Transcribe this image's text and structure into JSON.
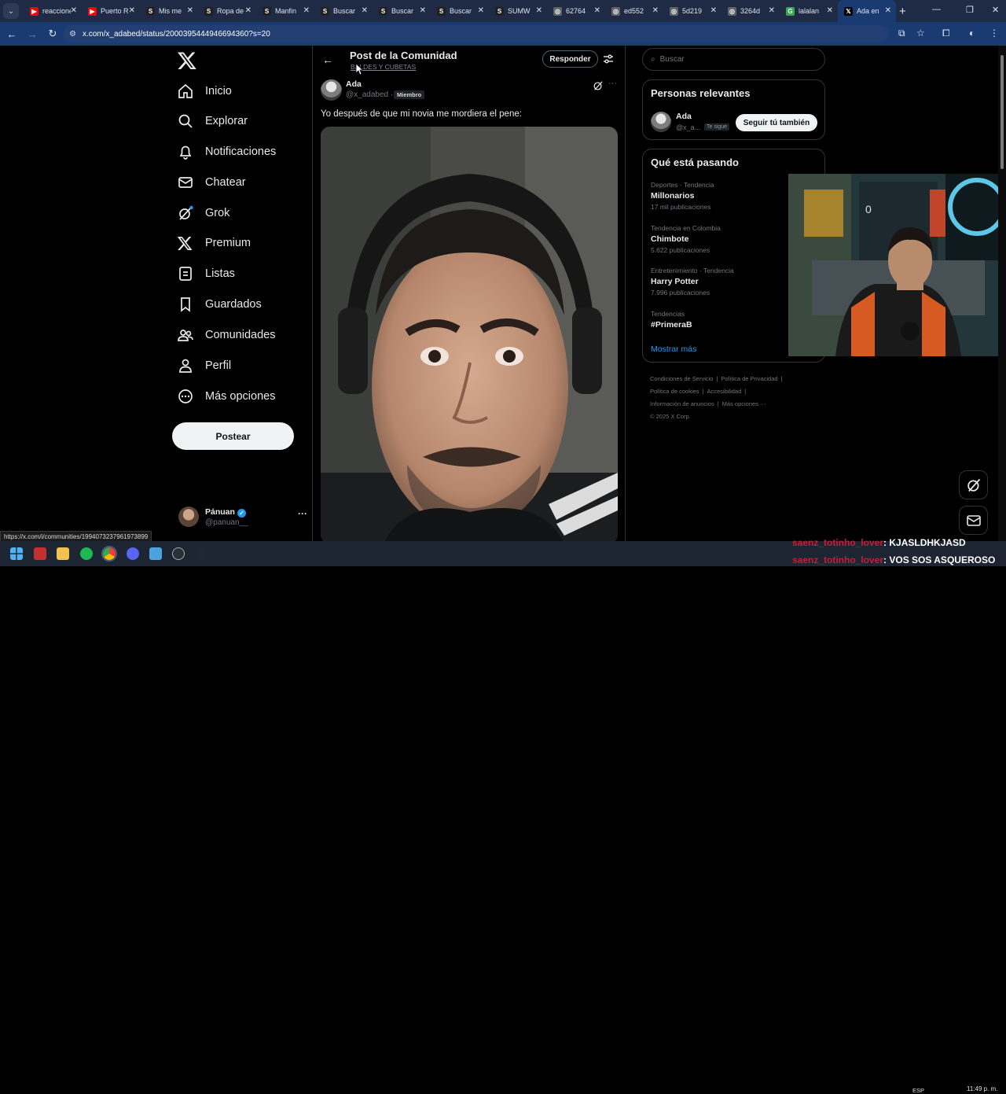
{
  "browser": {
    "tabs": [
      {
        "title": "reacciones",
        "color": "#ff0000",
        "glyph": "▶"
      },
      {
        "title": "Puerto Rico",
        "color": "#ff0000",
        "glyph": "▶"
      },
      {
        "title": "Mis me",
        "color": "#202020",
        "glyph": "S"
      },
      {
        "title": "Ropa de",
        "color": "#202020",
        "glyph": "S"
      },
      {
        "title": "Manfin",
        "color": "#202020",
        "glyph": "S"
      },
      {
        "title": "Buscar",
        "color": "#202020",
        "glyph": "S"
      },
      {
        "title": "Buscar",
        "color": "#202020",
        "glyph": "S"
      },
      {
        "title": "Buscar",
        "color": "#202020",
        "glyph": "S"
      },
      {
        "title": "SUMW",
        "color": "#202020",
        "glyph": "S"
      },
      {
        "title": "62764",
        "color": "#5f6368",
        "glyph": "◎"
      },
      {
        "title": "ed552",
        "color": "#5f6368",
        "glyph": "◎"
      },
      {
        "title": "5d219",
        "color": "#5f6368",
        "glyph": "◎"
      },
      {
        "title": "3264d",
        "color": "#5f6368",
        "glyph": "◎"
      },
      {
        "title": "lalalan",
        "color": "#34a853",
        "glyph": "G"
      },
      {
        "title": "Ada en",
        "color": "#000000",
        "glyph": "𝕏"
      }
    ],
    "url": "x.com/x_adabed/status/2000395444946694360?s=20",
    "status_url": "https://x.com/i/communities/1994073237961973899"
  },
  "sidebar": {
    "items": [
      {
        "label": "Inicio",
        "icon": "home-icon"
      },
      {
        "label": "Explorar",
        "icon": "search-icon"
      },
      {
        "label": "Notificaciones",
        "icon": "bell-icon"
      },
      {
        "label": "Chatear",
        "icon": "mail-icon"
      },
      {
        "label": "Grok",
        "icon": "grok-icon"
      },
      {
        "label": "Premium",
        "icon": "x-icon"
      },
      {
        "label": "Listas",
        "icon": "list-icon"
      },
      {
        "label": "Guardados",
        "icon": "bookmark-icon"
      },
      {
        "label": "Comunidades",
        "icon": "people-icon"
      },
      {
        "label": "Perfil",
        "icon": "person-icon"
      },
      {
        "label": "Más opciones",
        "icon": "more-circle-icon"
      }
    ],
    "post_label": "Postear",
    "account": {
      "name": "Pánuan",
      "handle": "@panuan__"
    }
  },
  "main": {
    "title": "Post de la Comunidad",
    "community": "BALDES Y CUBETAS",
    "reply_label": "Responder",
    "post": {
      "author": "Ada",
      "handle": "@x_adabed ·",
      "badge": "Miembro",
      "text": "Yo después de que mi novia me mordiera el pene:"
    }
  },
  "right": {
    "search_placeholder": "Buscar",
    "relevant": {
      "title": "Personas relevantes",
      "name": "Ada",
      "handle": "@x_a...",
      "badge": "Te sigue",
      "follow_label": "Seguir tú también"
    },
    "trending": {
      "title": "Qué está pasando",
      "items": [
        {
          "context": "Deportes · Tendencia",
          "topic": "Millonarios",
          "count": "17 mil publicaciones"
        },
        {
          "context": "Tendencia en Colombia",
          "topic": "Chimbote",
          "count": "5.622 publicaciones"
        },
        {
          "context": "Entretenimiento · Tendencia",
          "topic": "Harry Potter",
          "count": "7.996 publicaciones"
        },
        {
          "context": "Tendencias",
          "topic": "#PrimeraB",
          "count": ""
        }
      ],
      "show_more": "Mostrar más"
    },
    "footer": [
      "Condiciones de Servicio",
      "|",
      "Política de Privacidad",
      "|",
      "Política de cookies",
      "|",
      "Accesibilidad",
      "|",
      "Información de anuncios",
      "|",
      "Más opciones ···",
      "© 2025 X Corp."
    ]
  },
  "chat": [
    {
      "user": "saenz_totinho_lover",
      "message": ": KJASLDHKJASD"
    },
    {
      "user": "saenz_totinho_lover",
      "message": ": VOS SOS ASQUEROSO"
    }
  ],
  "taskbar": {
    "lang": "ESP",
    "time": "11:49 p. m."
  }
}
